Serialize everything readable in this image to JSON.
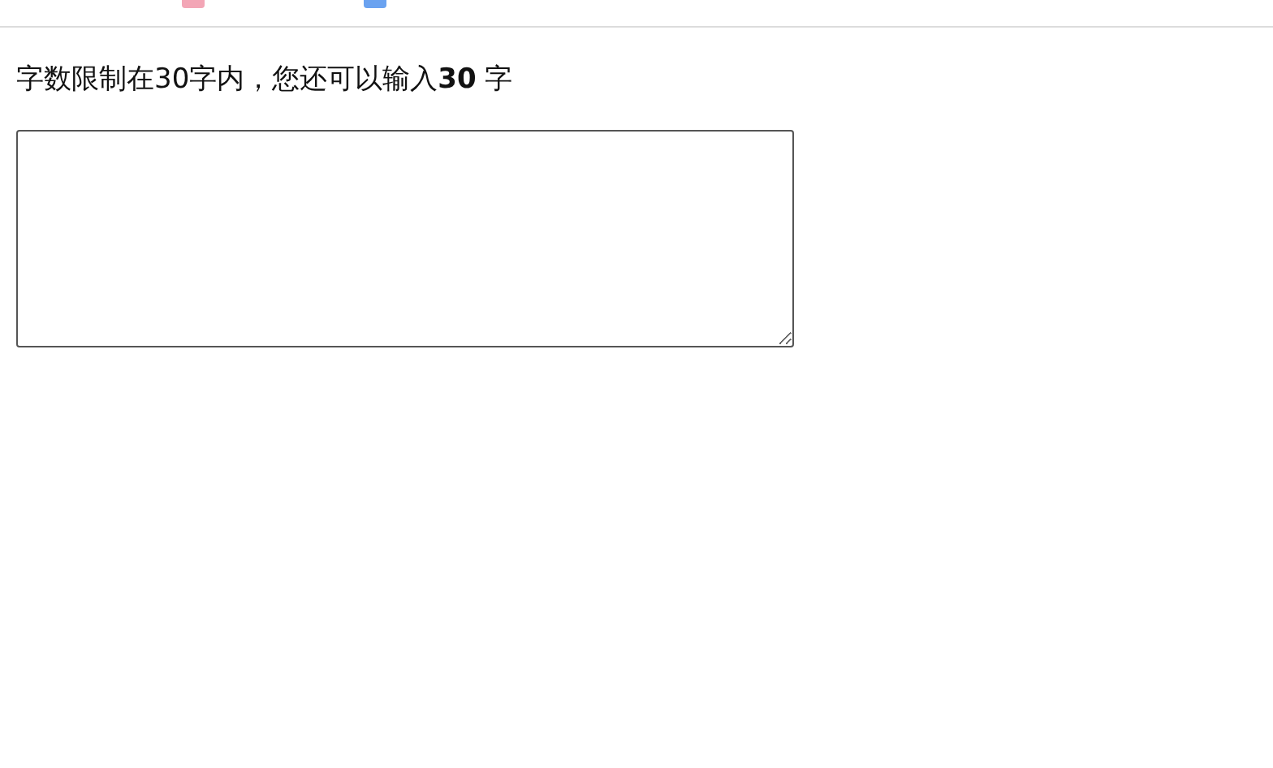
{
  "notice": "字数限制在30字内，您还可以输入**30** 字"
}
